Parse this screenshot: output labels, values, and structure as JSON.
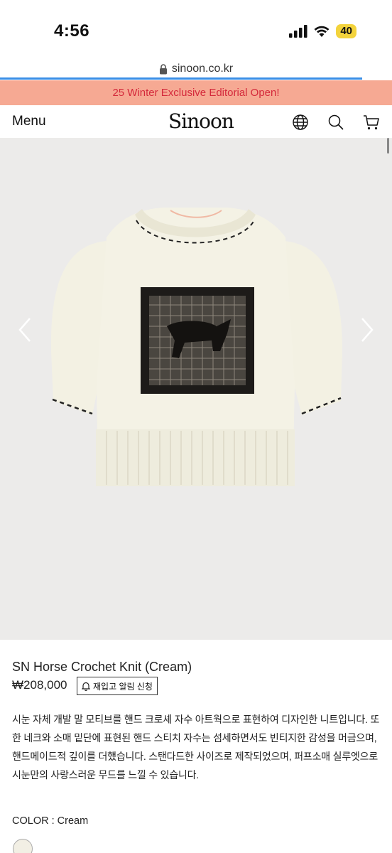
{
  "status_bar": {
    "time": "4:56",
    "battery": "40"
  },
  "browser": {
    "url": "sinoon.co.kr"
  },
  "promo": {
    "text": "25 Winter Exclusive Editorial Open!"
  },
  "header": {
    "menu_label": "Menu",
    "logo_text": "Sinoon",
    "icons": [
      "globe-icon",
      "search-icon",
      "cart-icon"
    ]
  },
  "gallery": {
    "image_alt": "SN Horse Crochet Knit (Cream)",
    "prev_icon": "chevron-left-icon",
    "next_icon": "chevron-right-icon"
  },
  "product": {
    "title": "SN Horse Crochet Knit (Cream)",
    "price": "₩208,000",
    "notify_label": "재입고 알림 신청",
    "description": "시눈 자체 개발 말 모티브를 핸드 크로셰 자수 아트웍으로 표현하여 디자인한 니트입니다. 또한 네크와 소매 밑단에 표현된 핸드 스티치 자수는 섬세하면서도 빈티지한 감성을 머금으며, 핸드메이드적 깊이를 더했습니다. 스탠다드한 사이즈로 제작되었으며, 퍼프소매 실루엣으로 시눈만의 사랑스러운 무드를 느낄 수 있습니다.",
    "color_label": "COLOR : Cream",
    "swatch_color": "#f2efe4"
  },
  "colors": {
    "promo_bg": "#f6a993",
    "promo_text": "#d4293b",
    "progress": "#3a8ee6"
  }
}
